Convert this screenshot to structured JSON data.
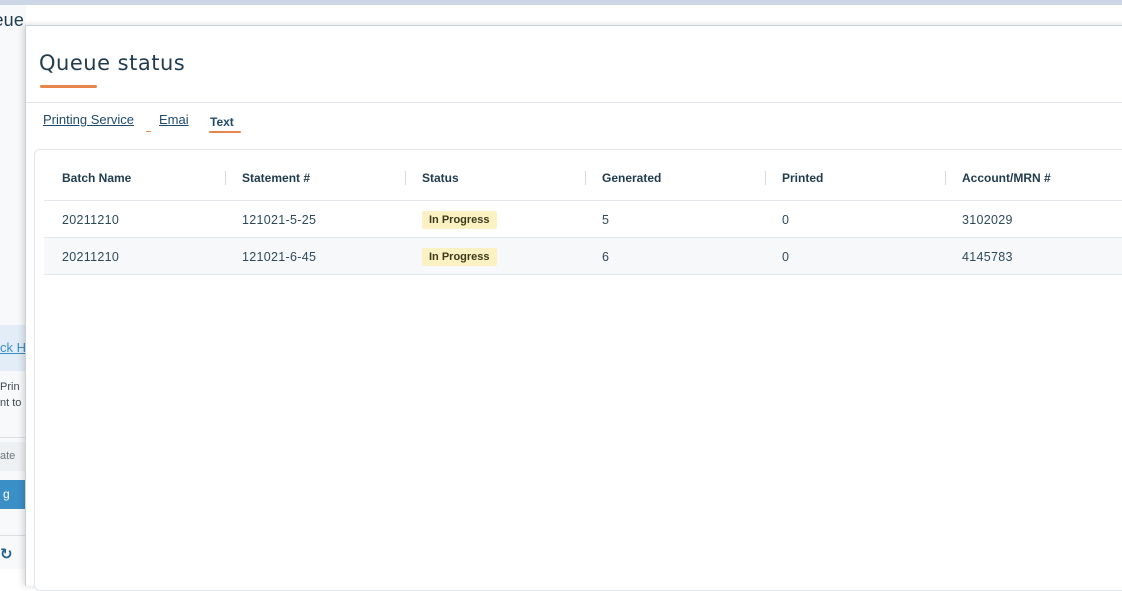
{
  "background": {
    "title_fragment": "nent Queue",
    "link_fragment": "ck H",
    "text_line1_fragment": "Prin",
    "text_line2_fragment": "nt to",
    "input_fragment": "ate",
    "button_fragment": "g",
    "icon": "refresh-icon"
  },
  "modal": {
    "title": "Queue status",
    "accent_color": "#e8854a",
    "tabs": [
      {
        "label": "Printing Service"
      },
      {
        "label": "Emai"
      },
      {
        "label": "Text",
        "active": true
      }
    ],
    "table": {
      "columns": [
        "Batch Name",
        "Statement #",
        "Status",
        "Generated",
        "Printed",
        "Account/MRN #"
      ],
      "rows": [
        {
          "batch": "20211210",
          "statement": "121021-5-25",
          "status": "In Progress",
          "generated": "5",
          "printed": "0",
          "account": "3102029"
        },
        {
          "batch": "20211210",
          "statement": "121021-6-45",
          "status": "In Progress",
          "generated": "6",
          "printed": "0",
          "account": "4145783"
        }
      ]
    }
  }
}
